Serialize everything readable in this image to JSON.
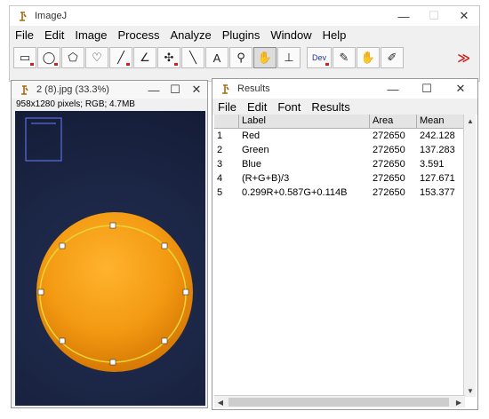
{
  "app": {
    "title": "ImageJ",
    "menu": [
      "File",
      "Edit",
      "Image",
      "Process",
      "Analyze",
      "Plugins",
      "Window",
      "Help"
    ],
    "tools": [
      {
        "icon": "rectangle-tool-icon",
        "glyph": "▭"
      },
      {
        "icon": "oval-tool-icon",
        "glyph": "◯"
      },
      {
        "icon": "polygon-tool-icon",
        "glyph": "⬠"
      },
      {
        "icon": "freehand-tool-icon",
        "glyph": "♡"
      },
      {
        "icon": "line-tool-icon",
        "glyph": "╱"
      },
      {
        "icon": "angle-tool-icon",
        "glyph": "∠"
      },
      {
        "icon": "point-tool-icon",
        "glyph": "✣"
      },
      {
        "icon": "wand-tool-icon",
        "glyph": "╲"
      },
      {
        "icon": "text-tool-icon",
        "glyph": "A"
      },
      {
        "icon": "magnifier-tool-icon",
        "glyph": "⚲"
      },
      {
        "icon": "hand-tool-icon",
        "glyph": "✋"
      },
      {
        "icon": "dropper-tool-icon",
        "glyph": "⊥"
      },
      {
        "icon": "dev-tool-icon",
        "glyph": "Dev"
      },
      {
        "icon": "brush-tool-icon",
        "glyph": "✎"
      },
      {
        "icon": "fill-tool-icon",
        "glyph": "✋"
      },
      {
        "icon": "pipette-tool-icon",
        "glyph": "✐"
      }
    ],
    "more": "≫"
  },
  "image_window": {
    "title": "2 (8).jpg (33.3%)",
    "info": "958x1280 pixels; RGB; 4.7MB"
  },
  "results_window": {
    "title": "Results",
    "menu": [
      "File",
      "Edit",
      "Font",
      "Results"
    ],
    "columns": [
      "",
      "Label",
      "Area",
      "Mean"
    ],
    "rows": [
      [
        "1",
        "Red",
        "272650",
        "242.128"
      ],
      [
        "2",
        "Green",
        "272650",
        "137.283"
      ],
      [
        "3",
        "Blue",
        "272650",
        "3.591"
      ],
      [
        "4",
        "(R+G+B)/3",
        "272650",
        "127.671"
      ],
      [
        "5",
        "0.299R+0.587G+0.114B",
        "272650",
        "153.377"
      ]
    ]
  },
  "window_controls": {
    "minimize": "—",
    "maximize": "☐",
    "close": "✕"
  },
  "colors": {
    "orange": "#f39a12",
    "selection": "#e8d43a",
    "background": "#1b2544"
  }
}
